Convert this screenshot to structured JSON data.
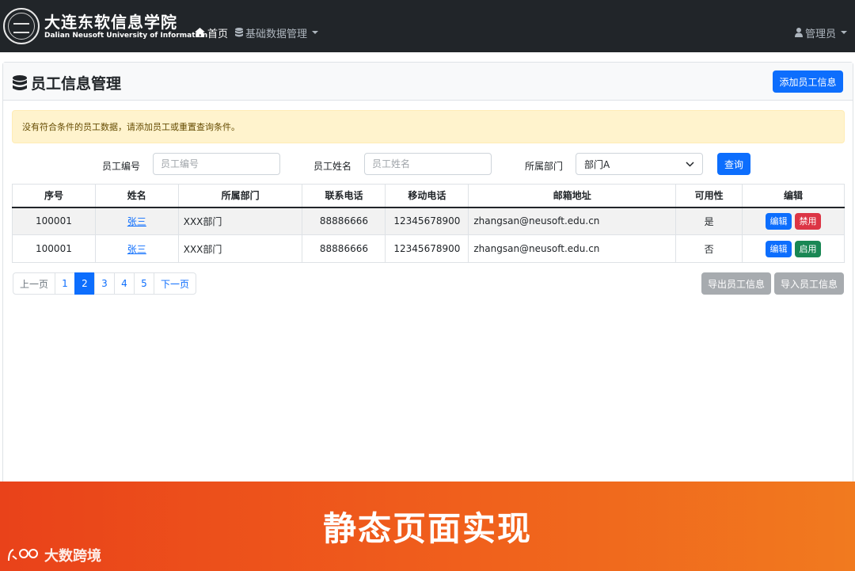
{
  "navbar": {
    "logo_cn": "大连东软信息学院",
    "logo_en": "Dalian Neusoft University of Information",
    "home": "首页",
    "data_menu": "基础数据管理",
    "user": "管理员"
  },
  "header": {
    "title": "员工信息管理",
    "add_button": "添加员工信息"
  },
  "alert": {
    "message": "没有符合条件的员工数据，请添加员工或重置查询条件。"
  },
  "search": {
    "id_label": "员工编号",
    "id_placeholder": "员工编号",
    "name_label": "员工姓名",
    "name_placeholder": "员工姓名",
    "dept_label": "所属部门",
    "dept_selected": "部门A",
    "query_button": "查询"
  },
  "table": {
    "columns": [
      "序号",
      "姓名",
      "所属部门",
      "联系电话",
      "移动电话",
      "邮箱地址",
      "可用性",
      "编辑"
    ],
    "rows": [
      {
        "id": "100001",
        "name": "张三",
        "dept": "XXX部门",
        "phone": "88886666",
        "mobile": "12345678900",
        "email": "zhangsan@neusoft.edu.cn",
        "available": "是",
        "edit": "编辑",
        "toggle": "禁用"
      },
      {
        "id": "100001",
        "name": "张三",
        "dept": "XXX部门",
        "phone": "88886666",
        "mobile": "12345678900",
        "email": "zhangsan@neusoft.edu.cn",
        "available": "否",
        "edit": "编辑",
        "toggle": "启用"
      }
    ]
  },
  "pagination": {
    "prev": "上一页",
    "pages": [
      "1",
      "2",
      "3",
      "4",
      "5"
    ],
    "next": "下一页",
    "current": "2"
  },
  "actions": {
    "export": "导出员工信息",
    "import": "导入员工信息"
  },
  "banner": {
    "title": "静态页面实现",
    "watermark": "大数跨境"
  },
  "colors": {
    "navbar": "#212529",
    "primary": "#0d6efd",
    "danger": "#dc3545",
    "success": "#198754",
    "secondary": "#a7abaf",
    "alert_bg": "#fff3cd",
    "banner_start": "#e9421a",
    "banner_end": "#f17a1f"
  },
  "icons": {
    "home": "home-icon",
    "database": "database-icon",
    "user": "user-icon"
  }
}
